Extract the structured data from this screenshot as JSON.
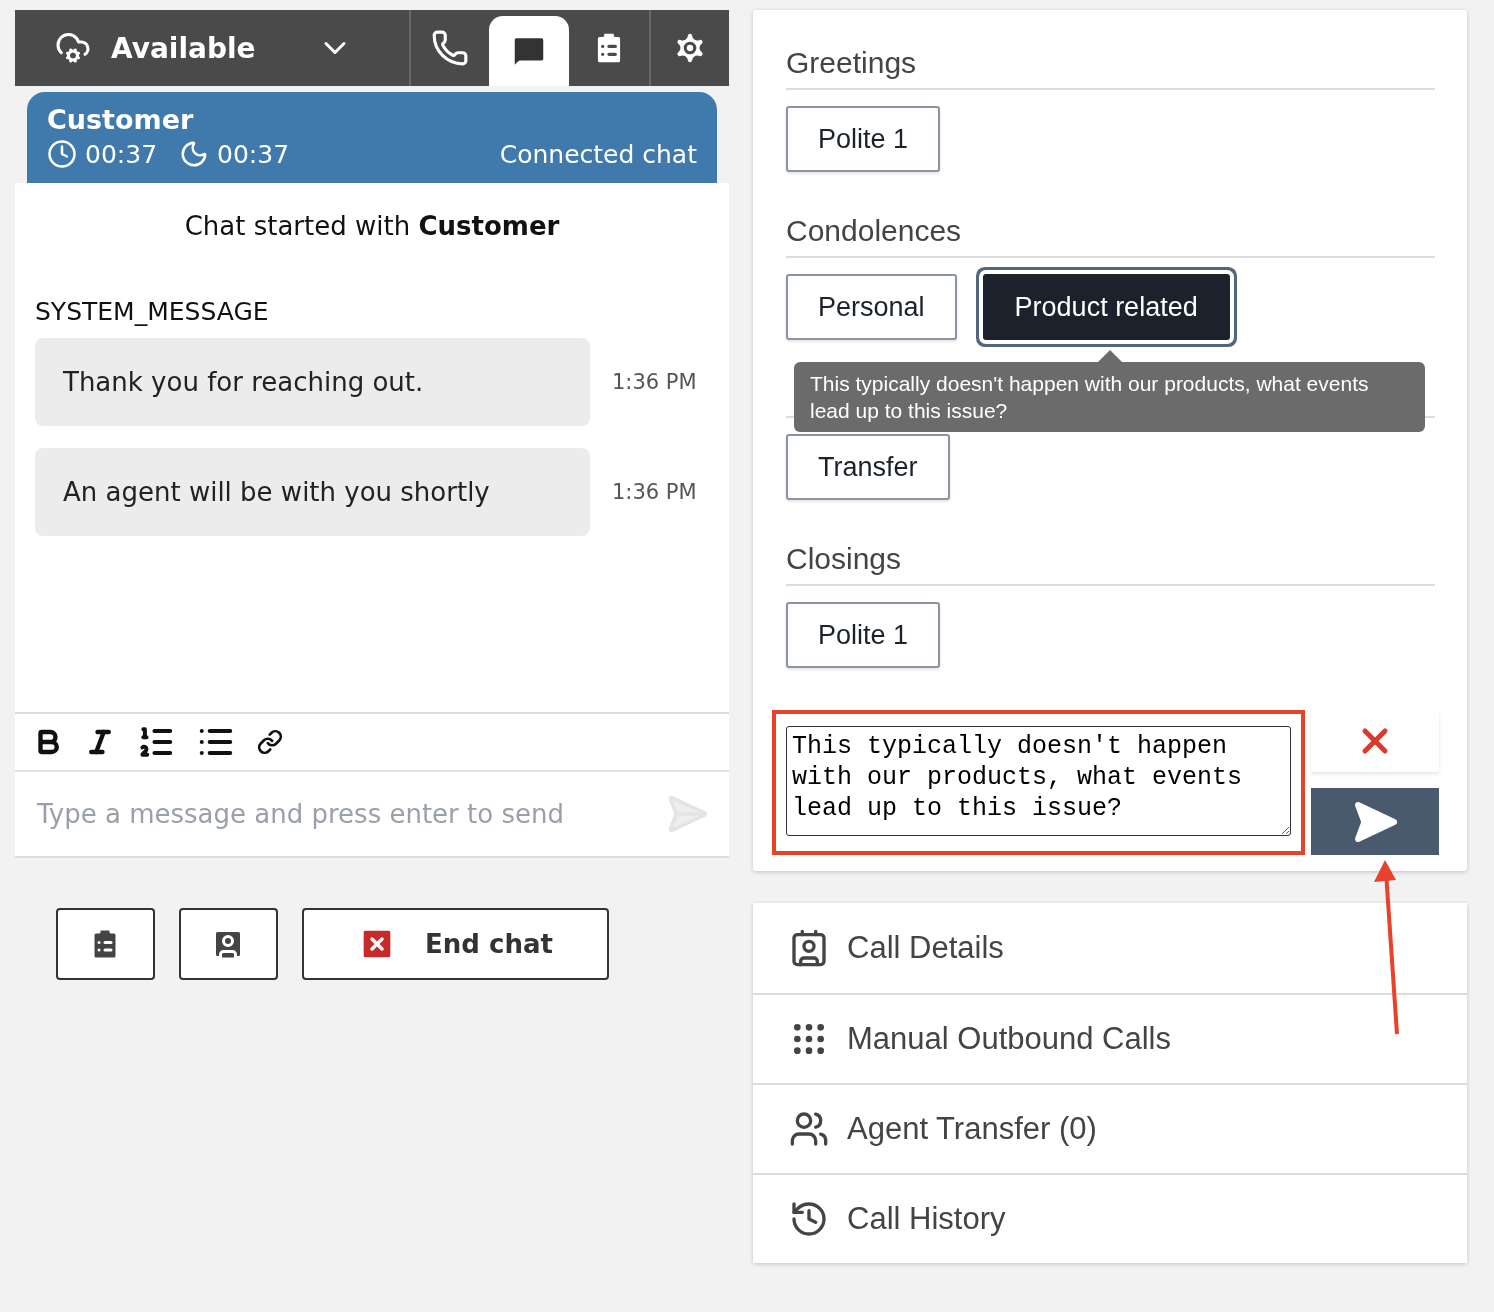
{
  "agent_bar": {
    "status": "Available",
    "tabs": [
      {
        "kind": "phone",
        "selected": false
      },
      {
        "kind": "chat",
        "selected": true
      },
      {
        "kind": "tasks",
        "selected": false
      },
      {
        "kind": "settings",
        "selected": false
      }
    ]
  },
  "contact": {
    "name": "Customer",
    "timers": [
      {
        "kind": "elapsed",
        "value": "00:37"
      },
      {
        "kind": "wait",
        "value": "00:37"
      }
    ],
    "state": "Connected chat"
  },
  "chat": {
    "intro": "Chat started with  **Customer**",
    "sender": "SYSTEM_MESSAGE",
    "messages": [
      {
        "text": "Thank you for reaching out.",
        "time": "1:36 PM"
      },
      {
        "text": "An agent will be with you shortly",
        "time": "1:36 PM"
      }
    ]
  },
  "composer": {
    "placeholder": "Type a message and press enter to send"
  },
  "actions": {
    "end_label": "End chat"
  },
  "quick_responses": {
    "sections": [
      {
        "heading": "Greetings",
        "options": [
          {
            "label": "Polite 1",
            "selected": false
          }
        ]
      },
      {
        "heading": "Condolences",
        "options": [
          {
            "label": "Personal",
            "selected": false
          },
          {
            "label": "Product related",
            "selected": true
          }
        ]
      },
      {
        "options": [
          {
            "label": "Transfer",
            "selected": false
          }
        ]
      },
      {
        "heading": "Closings",
        "options": [
          {
            "label": "Polite 1",
            "selected": false
          }
        ]
      }
    ],
    "tooltip": "This typically doesn't happen with our products, what events lead up to this issue?"
  },
  "draft": {
    "value": "This typically doesn't happen with our products, what events lead up to this issue?"
  },
  "menu": [
    {
      "kind": "details",
      "label": "Call Details"
    },
    {
      "kind": "dialpad",
      "label": "Manual Outbound Calls"
    },
    {
      "kind": "transfer",
      "label": "Agent Transfer (0)"
    },
    {
      "kind": "history",
      "label": "Call History"
    }
  ]
}
